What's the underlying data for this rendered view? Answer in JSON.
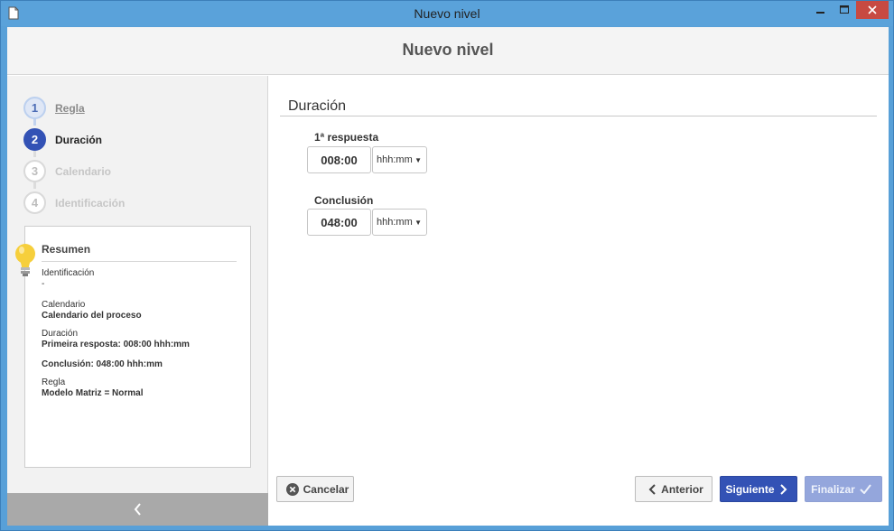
{
  "window": {
    "title": "Nuevo nivel"
  },
  "header": {
    "title": "Nuevo nivel"
  },
  "steps": [
    {
      "number": "1",
      "label": "Regla",
      "state": "done"
    },
    {
      "number": "2",
      "label": "Duración",
      "state": "active"
    },
    {
      "number": "3",
      "label": "Calendario",
      "state": "todo"
    },
    {
      "number": "4",
      "label": "Identificación",
      "state": "todo"
    }
  ],
  "summary": {
    "title": "Resumen",
    "identificacion_label": "Identificación",
    "identificacion_value": "-",
    "calendario_label": "Calendario",
    "calendario_value": "Calendario del proceso",
    "duracion_label": "Duración",
    "duracion_value1": "Primeira resposta: 008:00 hhh:mm",
    "duracion_value2": "Conclusión: 048:00 hhh:mm",
    "regla_label": "Regla",
    "regla_value": "Modelo Matriz = Normal"
  },
  "main": {
    "section_title": "Duración",
    "first_response": {
      "label": "1ª respuesta",
      "value": "008:00",
      "unit": "hhh:mm"
    },
    "conclusion": {
      "label": "Conclusión",
      "value": "048:00",
      "unit": "hhh:mm"
    }
  },
  "buttons": {
    "cancel": "Cancelar",
    "previous": "Anterior",
    "next": "Siguiente",
    "finish": "Finalizar"
  },
  "colors": {
    "accent": "#3352b5",
    "titlebar": "#5aa2da",
    "close": "#c74a42"
  }
}
